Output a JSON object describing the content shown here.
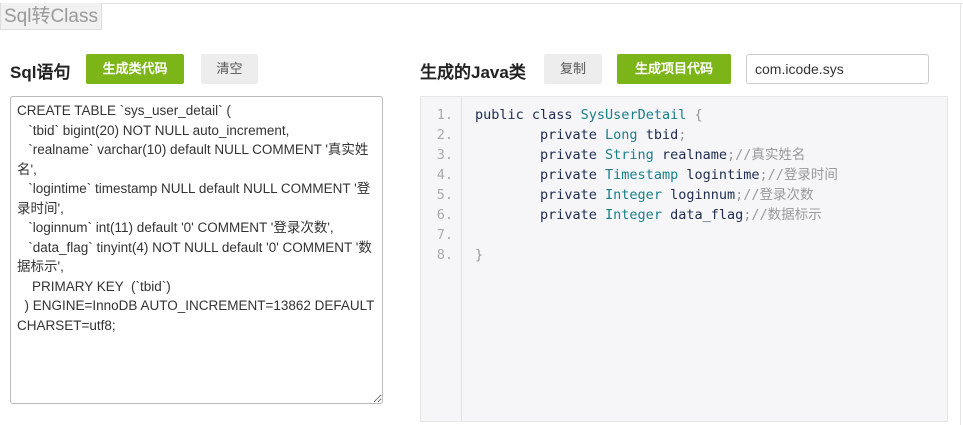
{
  "tab_title": "Sql转Class",
  "left": {
    "heading": "Sql语句",
    "generate_label": "生成类代码",
    "clear_label": "清空",
    "sql": "CREATE TABLE `sys_user_detail` (\n   `tbid` bigint(20) NOT NULL auto_increment,\n   `realname` varchar(10) default NULL COMMENT '真实姓名',\n   `logintime` timestamp NULL default NULL COMMENT '登录时间',\n   `loginnum` int(11) default '0' COMMENT '登录次数',\n   `data_flag` tinyint(4) NOT NULL default '0' COMMENT '数据标示',\n    PRIMARY KEY  (`tbid`)\n  ) ENGINE=InnoDB AUTO_INCREMENT=13862 DEFAULT CHARSET=utf8;"
  },
  "right": {
    "heading": "生成的Java类",
    "copy_label": "复制",
    "generate_project_label": "生成项目代码",
    "package_value": "com.icode.sys",
    "line_numbers": [
      "1.",
      "2.",
      "3.",
      "4.",
      "5.",
      "6.",
      "7.",
      "8."
    ],
    "code": [
      {
        "kw": "public class ",
        "type": "SysUserDetail",
        "rest": " ",
        "punct": "{",
        "comment": ""
      },
      {
        "kw": "        private ",
        "type": "Long",
        "rest": " tbid",
        "punct": ";",
        "comment": ""
      },
      {
        "kw": "        private ",
        "type": "String",
        "rest": " realname",
        "punct": ";//",
        "comment": "真实姓名"
      },
      {
        "kw": "        private ",
        "type": "Timestamp",
        "rest": " logintime",
        "punct": ";//",
        "comment": "登录时间"
      },
      {
        "kw": "        private ",
        "type": "Integer",
        "rest": " loginnum",
        "punct": ";//",
        "comment": "登录次数"
      },
      {
        "kw": "        private ",
        "type": "Integer",
        "rest": " data_flag",
        "punct": ";//",
        "comment": "数据标示"
      },
      {
        "kw": "",
        "type": "",
        "rest": "",
        "punct": "",
        "comment": ""
      },
      {
        "kw": "",
        "type": "",
        "rest": "",
        "punct": "}",
        "comment": ""
      }
    ]
  },
  "colors": {
    "accent": "#7cb518"
  }
}
